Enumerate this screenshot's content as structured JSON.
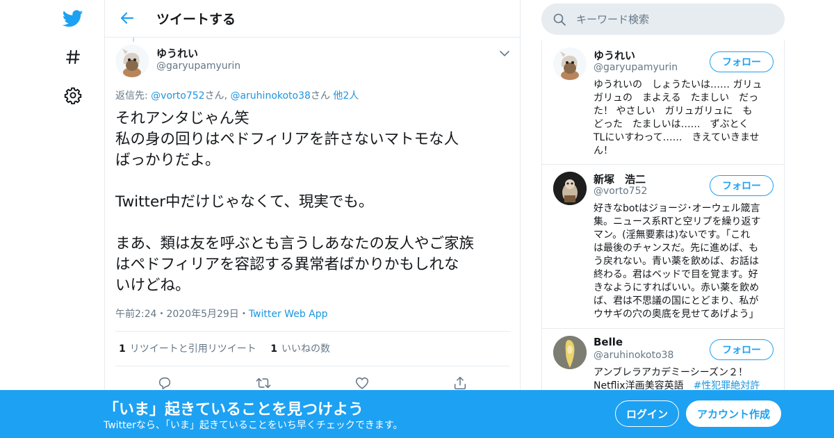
{
  "colors": {
    "accent": "#1da1f2",
    "link": "#1b95e0",
    "secondary_text": "#657786",
    "border": "#e6ecf0"
  },
  "nav": {
    "icons": [
      "twitter-logo-icon",
      "hashtag-icon",
      "gear-icon"
    ]
  },
  "header": {
    "title": "ツイートする",
    "back_icon": "arrow-left-icon"
  },
  "tweet": {
    "author_name": "ゆうれい",
    "author_handle": "@garyupamyurin",
    "reply_prefix": "返信先: ",
    "reply_user1": "@vorto752",
    "reply_san1": "さん",
    "reply_comma": ", ",
    "reply_user2": "@aruhinokoto38",
    "reply_san2": "さん",
    "reply_others": "他2人",
    "text_lines": [
      "それアンタじゃん笑",
      "私の身の回りはペドフィリアを許さないマトモな人",
      "ばっかりだよ。",
      "",
      "Twitter中だけじゃなくて、現実でも。",
      "",
      "まあ、類は友を呼ぶとも言うしあなたの友人やご家族",
      "はペドフィリアを容認する異常者ばかりかもしれな",
      "いけどね。"
    ],
    "time": "午前2:24",
    "dot": "・",
    "date": "2020年5月29日",
    "source": "Twitter Web App",
    "retweet_count": "1",
    "retweet_label": "リツイートと引用リツイート",
    "like_count": "1",
    "like_label": "いいねの数",
    "actions": [
      "reply-icon",
      "retweet-icon",
      "like-icon",
      "share-icon"
    ]
  },
  "search": {
    "placeholder": "キーワード検索",
    "value": ""
  },
  "users": [
    {
      "name": "ゆうれい",
      "handle": "@garyupamyurin",
      "follow_label": "フォロー",
      "bio_lines": [
        "ゆうれいの　しょうたいは…… ガリュ",
        "ガリュの　まよえる　たましい　だっ",
        "た！ やさしい　ガリュガリュに　も",
        "どった　たましいは……　ずぶとく",
        "TLにいすわって……　きえていきませ",
        "ん！"
      ]
    },
    {
      "name": "新塚　浩二",
      "handle": "@vorto752",
      "follow_label": "フォロー",
      "bio_lines": [
        "好きなbotはジョージ･オーウェル箴言",
        "集。ニュース系RTと空リプを繰り返す",
        "マン。(淫無要素は)ないです。「これ",
        "は最後のチャンスだ。先に進めば、も",
        "う戻れない。青い薬を飲めば、お話は",
        "終わる。君はベッドで目を覚ます。好",
        "きなようにすればいい。赤い薬を飲め",
        "ば、君は不思議の国にとどまり、私が",
        "ウサギの穴の奥底を見せてあげよう」"
      ]
    },
    {
      "name": "Belle",
      "handle": "@aruhinokoto38",
      "follow_label": "フォロー",
      "bio_line1": "アンブレラアカデミーシーズン２！",
      "bio_line2_text": "Netflix洋画美容英語　",
      "bio_line2_tag": "#性犯罪絶対許"
    }
  ],
  "banner": {
    "title": "「いま」起きていることを見つけよう",
    "subtitle": "Twitterなら、「いま」起きていることをいち早くチェックできます。",
    "login_label": "ログイン",
    "signup_label": "アカウント作成"
  }
}
